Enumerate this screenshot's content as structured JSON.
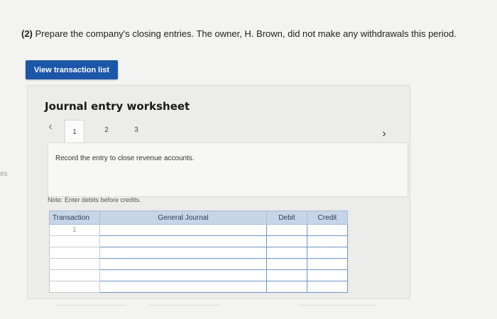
{
  "question": {
    "number": "(2)",
    "text": "Prepare the company's closing entries. The owner, H. Brown, did not make any withdrawals this period."
  },
  "side_fragment": "es",
  "view_transaction_button": "View transaction list",
  "worksheet": {
    "title": "Journal entry worksheet",
    "tabs": [
      "1",
      "2",
      "3"
    ],
    "active_tab": "1",
    "instruction": "Record the entry to close revenue accounts.",
    "note": "Note: Enter debits before credits.",
    "table": {
      "headers": [
        "Transaction",
        "General Journal",
        "Debit",
        "Credit"
      ],
      "rows": [
        {
          "transaction": "1",
          "account": "",
          "debit": "",
          "credit": ""
        },
        {
          "transaction": "",
          "account": "",
          "debit": "",
          "credit": ""
        },
        {
          "transaction": "",
          "account": "",
          "debit": "",
          "credit": ""
        },
        {
          "transaction": "",
          "account": "",
          "debit": "",
          "credit": ""
        },
        {
          "transaction": "",
          "account": "",
          "debit": "",
          "credit": ""
        },
        {
          "transaction": "",
          "account": "",
          "debit": "",
          "credit": ""
        }
      ]
    }
  },
  "colors": {
    "button_bg": "#1c56a8",
    "table_header_bg": "#c6d6e8",
    "input_border": "#6f93c5"
  }
}
